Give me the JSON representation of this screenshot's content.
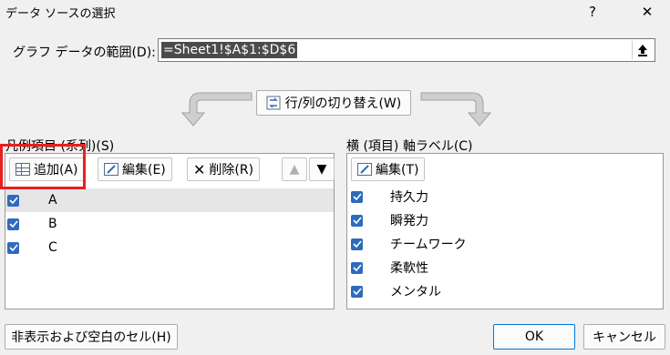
{
  "window": {
    "title": "データ ソースの選択",
    "help": "?",
    "close": "✕"
  },
  "range": {
    "label": "グラフ データの範囲(D):",
    "value": "=Sheet1!$A$1:$D$6"
  },
  "switch_button": "行/列の切り替え(W)",
  "legend": {
    "header": "凡例項目 (系列)(S)",
    "add": "追加(A)",
    "edit": "編集(E)",
    "delete": "削除(R)",
    "items": [
      "A",
      "B",
      "C"
    ]
  },
  "axis": {
    "header": "横 (項目) 軸ラベル(C)",
    "edit": "編集(T)",
    "items": [
      "持久力",
      "瞬発力",
      "チームワーク",
      "柔軟性",
      "メンタル"
    ]
  },
  "footer": {
    "hidden_cells": "非表示および空白のセル(H)",
    "ok": "OK",
    "cancel": "キャンセル"
  },
  "colors": {
    "checkbox": "#2f6bbd",
    "selected_row": "#e6e6e6",
    "highlight": "#e8201f"
  }
}
